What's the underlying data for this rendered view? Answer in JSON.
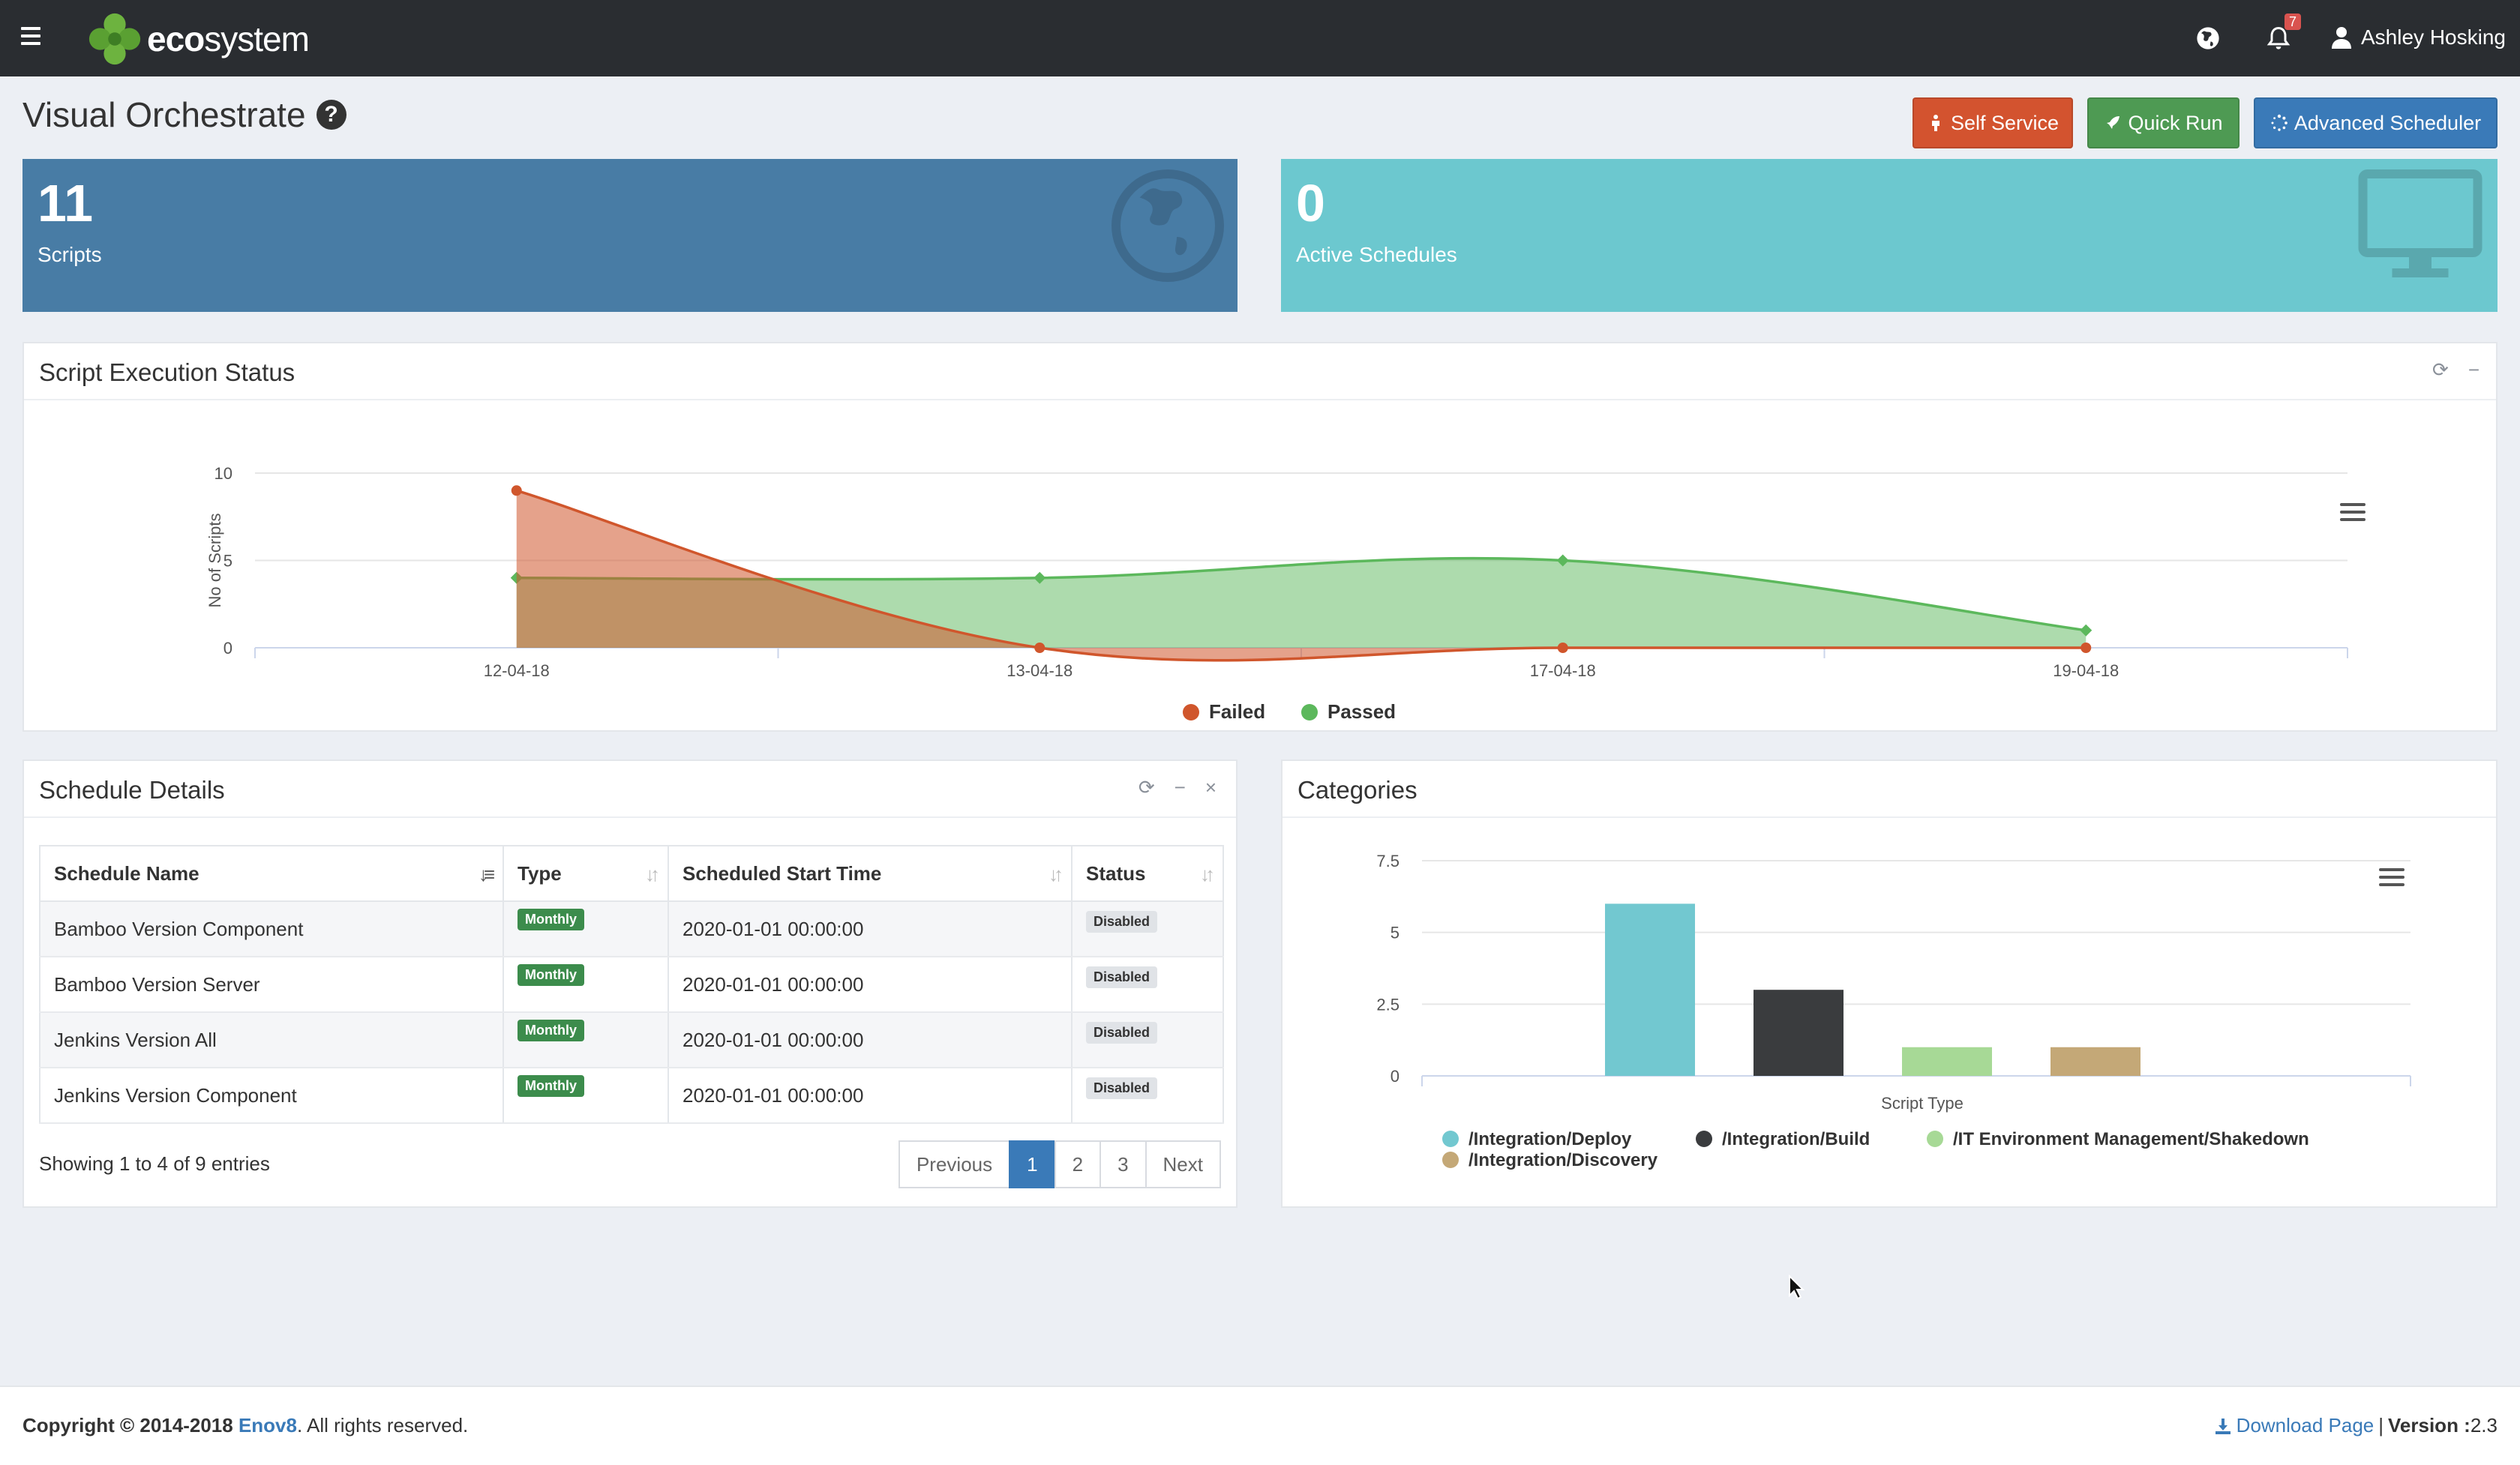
{
  "app": {
    "logo_bold": "eco",
    "logo_rest": "system",
    "notification_count": "7",
    "user_name": "Ashley Hosking"
  },
  "page": {
    "title": "Visual Orchestrate",
    "buttons": {
      "self_service": "Self Service",
      "quick_run": "Quick Run",
      "advanced_scheduler": "Advanced Scheduler"
    }
  },
  "stats": {
    "scripts": {
      "value": "11",
      "label": "Scripts"
    },
    "schedules": {
      "value": "0",
      "label": "Active Schedules"
    }
  },
  "execution_panel": {
    "title": "Script Execution Status"
  },
  "schedule_panel": {
    "title": "Schedule Details",
    "columns": [
      "Schedule Name",
      "Type",
      "Scheduled Start Time",
      "Status"
    ],
    "rows": [
      {
        "name": "Bamboo Version Component",
        "type": "Monthly",
        "start": "2020-01-01 00:00:00",
        "status": "Disabled"
      },
      {
        "name": "Bamboo Version Server",
        "type": "Monthly",
        "start": "2020-01-01 00:00:00",
        "status": "Disabled"
      },
      {
        "name": "Jenkins Version All",
        "type": "Monthly",
        "start": "2020-01-01 00:00:00",
        "status": "Disabled"
      },
      {
        "name": "Jenkins Version Component",
        "type": "Monthly",
        "start": "2020-01-01 00:00:00",
        "status": "Disabled"
      }
    ],
    "showing": "Showing 1 to 4 of 9 entries",
    "pagination": {
      "previous": "Previous",
      "pages": [
        "1",
        "2",
        "3"
      ],
      "current": "1",
      "next": "Next"
    }
  },
  "categories_panel": {
    "title": "Categories"
  },
  "footer": {
    "copyright_prefix": "Copyright © 2014-2018 ",
    "company": "Enov8",
    "copyright_suffix": ". All rights reserved.",
    "download": "Download Page",
    "version_label": "Version : ",
    "version": "2.3"
  },
  "colors": {
    "topbar": "#2a2d31",
    "self_service": "#d3532f",
    "quick_run": "#4e9a53",
    "advanced_scheduler": "#3a7ab8",
    "scripts_box": "#487ca5",
    "schedules_box": "#6cc8cf",
    "failed": "#d0562c",
    "passed": "#5cb85c"
  },
  "chart_data": [
    {
      "type": "area",
      "x": [
        "12-04-18",
        "13-04-18",
        "17-04-18",
        "19-04-18"
      ],
      "series": [
        {
          "name": "Failed",
          "values": [
            9,
            0,
            0,
            0
          ],
          "color": "#d0562c"
        },
        {
          "name": "Passed",
          "values": [
            4,
            4,
            5,
            1
          ],
          "color": "#5cb85c"
        }
      ],
      "ylabel": "No of Scripts",
      "ylim": [
        0,
        10
      ],
      "yticks": [
        "0",
        "5",
        "10"
      ],
      "grid": true,
      "legend": "bottom-center"
    },
    {
      "type": "bar",
      "categories": [
        "/Integration/Deploy",
        "/Integration/Build",
        "/IT Environment Management/Shakedown",
        "/Integration/Discovery"
      ],
      "values": [
        6,
        3,
        1,
        1
      ],
      "colors": [
        "#72c8d0",
        "#3a3c3e",
        "#a7d996",
        "#c4a877"
      ],
      "xlabel": "Script Type",
      "ylim": [
        0,
        7.5
      ],
      "yticks": [
        "0",
        "2.5",
        "5",
        "7.5"
      ],
      "grid": true,
      "legend": "bottom"
    }
  ]
}
